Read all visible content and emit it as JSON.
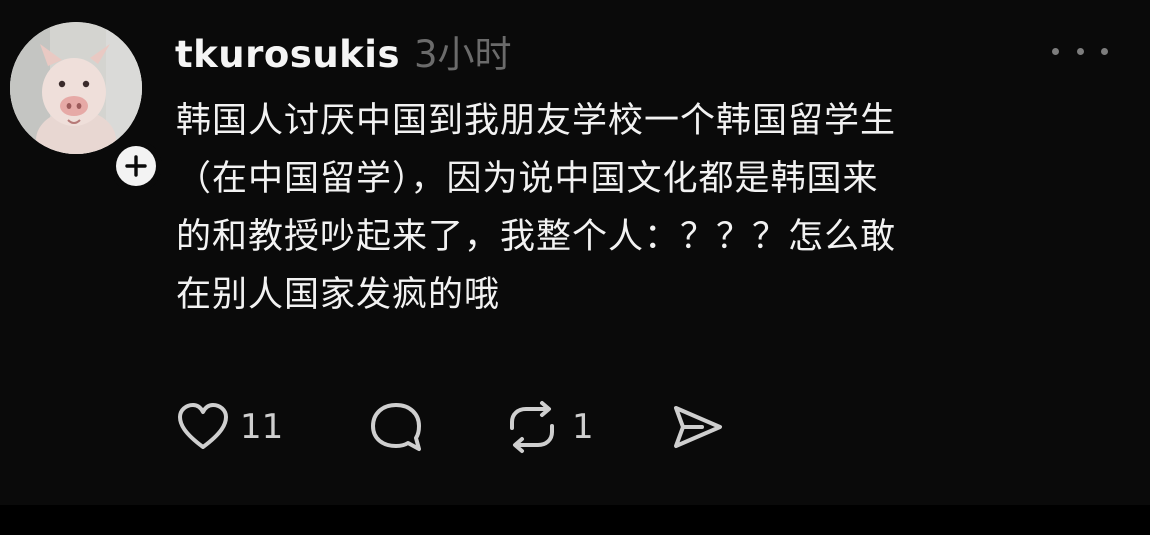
{
  "post": {
    "username": "tkurosukis",
    "timestamp": "3小时",
    "content_lines": [
      "韩国人讨厌中国到我朋友学校一个韩国留学生",
      "（在中国留学），因为说中国文化都是韩国来",
      "的和教授吵起来了，我整个人：？？？怎么敢",
      "在别人国家发疯的哦"
    ],
    "likes": "11",
    "reposts": "1"
  },
  "icons": {
    "avatar": "piglet-avatar",
    "follow": "plus-icon",
    "more": "more-horizontal-icon",
    "like": "heart-icon",
    "comment": "comment-bubble-icon",
    "repost": "repost-icon",
    "share": "send-icon"
  },
  "colors": {
    "background": "#0a0a0a",
    "text": "#f2f2f2",
    "muted": "#6b6b6b",
    "icon": "#cfcfcf"
  }
}
